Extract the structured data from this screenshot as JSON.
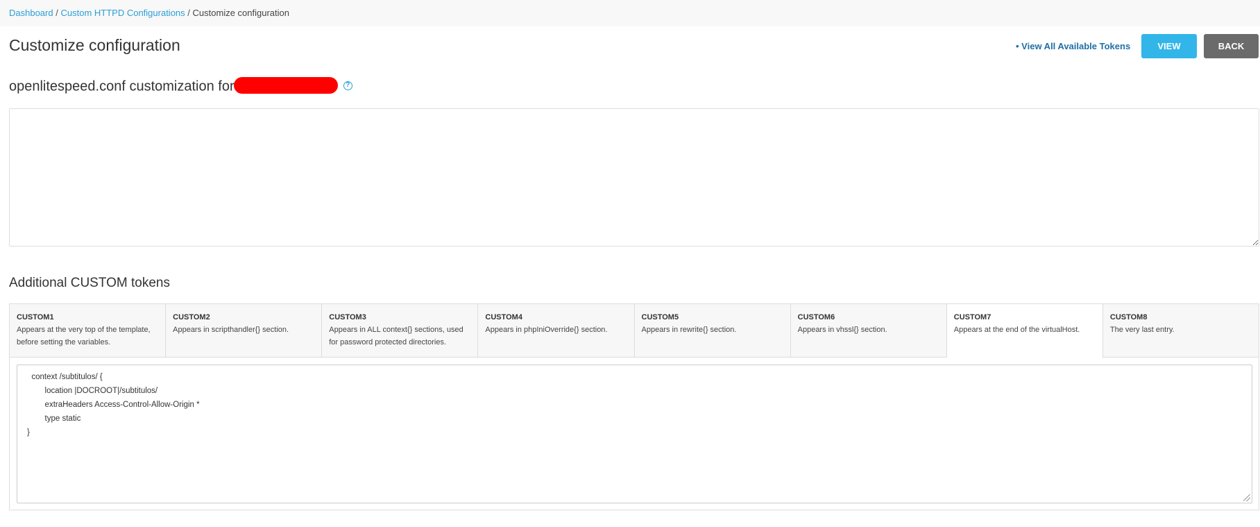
{
  "breadcrumb": {
    "items": [
      {
        "label": "Dashboard"
      },
      {
        "label": "Custom HTTPD Configurations"
      },
      {
        "label": "Customize configuration"
      }
    ],
    "separator": "/"
  },
  "header": {
    "title": "Customize configuration",
    "tokens_link": "• View All Available Tokens",
    "view_label": "VIEW",
    "back_label": "BACK"
  },
  "config_section": {
    "title_prefix": "openlitespeed.conf customization for",
    "help_icon": "?",
    "editor_value": ""
  },
  "custom_tokens": {
    "title": "Additional CUSTOM tokens",
    "tabs": [
      {
        "name": "CUSTOM1",
        "desc": "Appears at the very top of the template, before setting the variables."
      },
      {
        "name": "CUSTOM2",
        "desc": "Appears in scripthandler{} section."
      },
      {
        "name": "CUSTOM3",
        "desc": "Appears in ALL context{} sections, used for password protected directories."
      },
      {
        "name": "CUSTOM4",
        "desc": "Appears in phpIniOverride{} section."
      },
      {
        "name": "CUSTOM5",
        "desc": "Appears in rewrite{} section."
      },
      {
        "name": "CUSTOM6",
        "desc": "Appears in vhssl{} section."
      },
      {
        "name": "CUSTOM7",
        "desc": "Appears at the end of the virtualHost."
      },
      {
        "name": "CUSTOM8",
        "desc": "The very last entry."
      }
    ],
    "active_tab": "CUSTOM7",
    "code_lines": [
      "  context /subtitulos/ {",
      "        location |DOCROOT|/subtitulos/",
      "        extraHeaders Access-Control-Allow-Origin *",
      "        type static",
      "}"
    ]
  },
  "colors": {
    "link": "#2a9fd6",
    "view_button": "#32b5e9",
    "back_button": "#6b6b6b",
    "redaction": "#ff0000"
  }
}
